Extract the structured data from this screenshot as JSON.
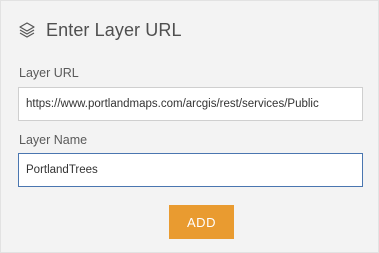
{
  "header": {
    "title": "Enter Layer URL",
    "icon": "layers-icon"
  },
  "form": {
    "url_label": "Layer URL",
    "url_value": "https://www.portlandmaps.com/arcgis/rest/services/Public",
    "name_label": "Layer Name",
    "name_value": "PortlandTrees"
  },
  "actions": {
    "add_label": "ADD"
  },
  "colors": {
    "accent": "#e99b30",
    "focus_border": "#4a76b0",
    "background": "#f3f3f3"
  }
}
